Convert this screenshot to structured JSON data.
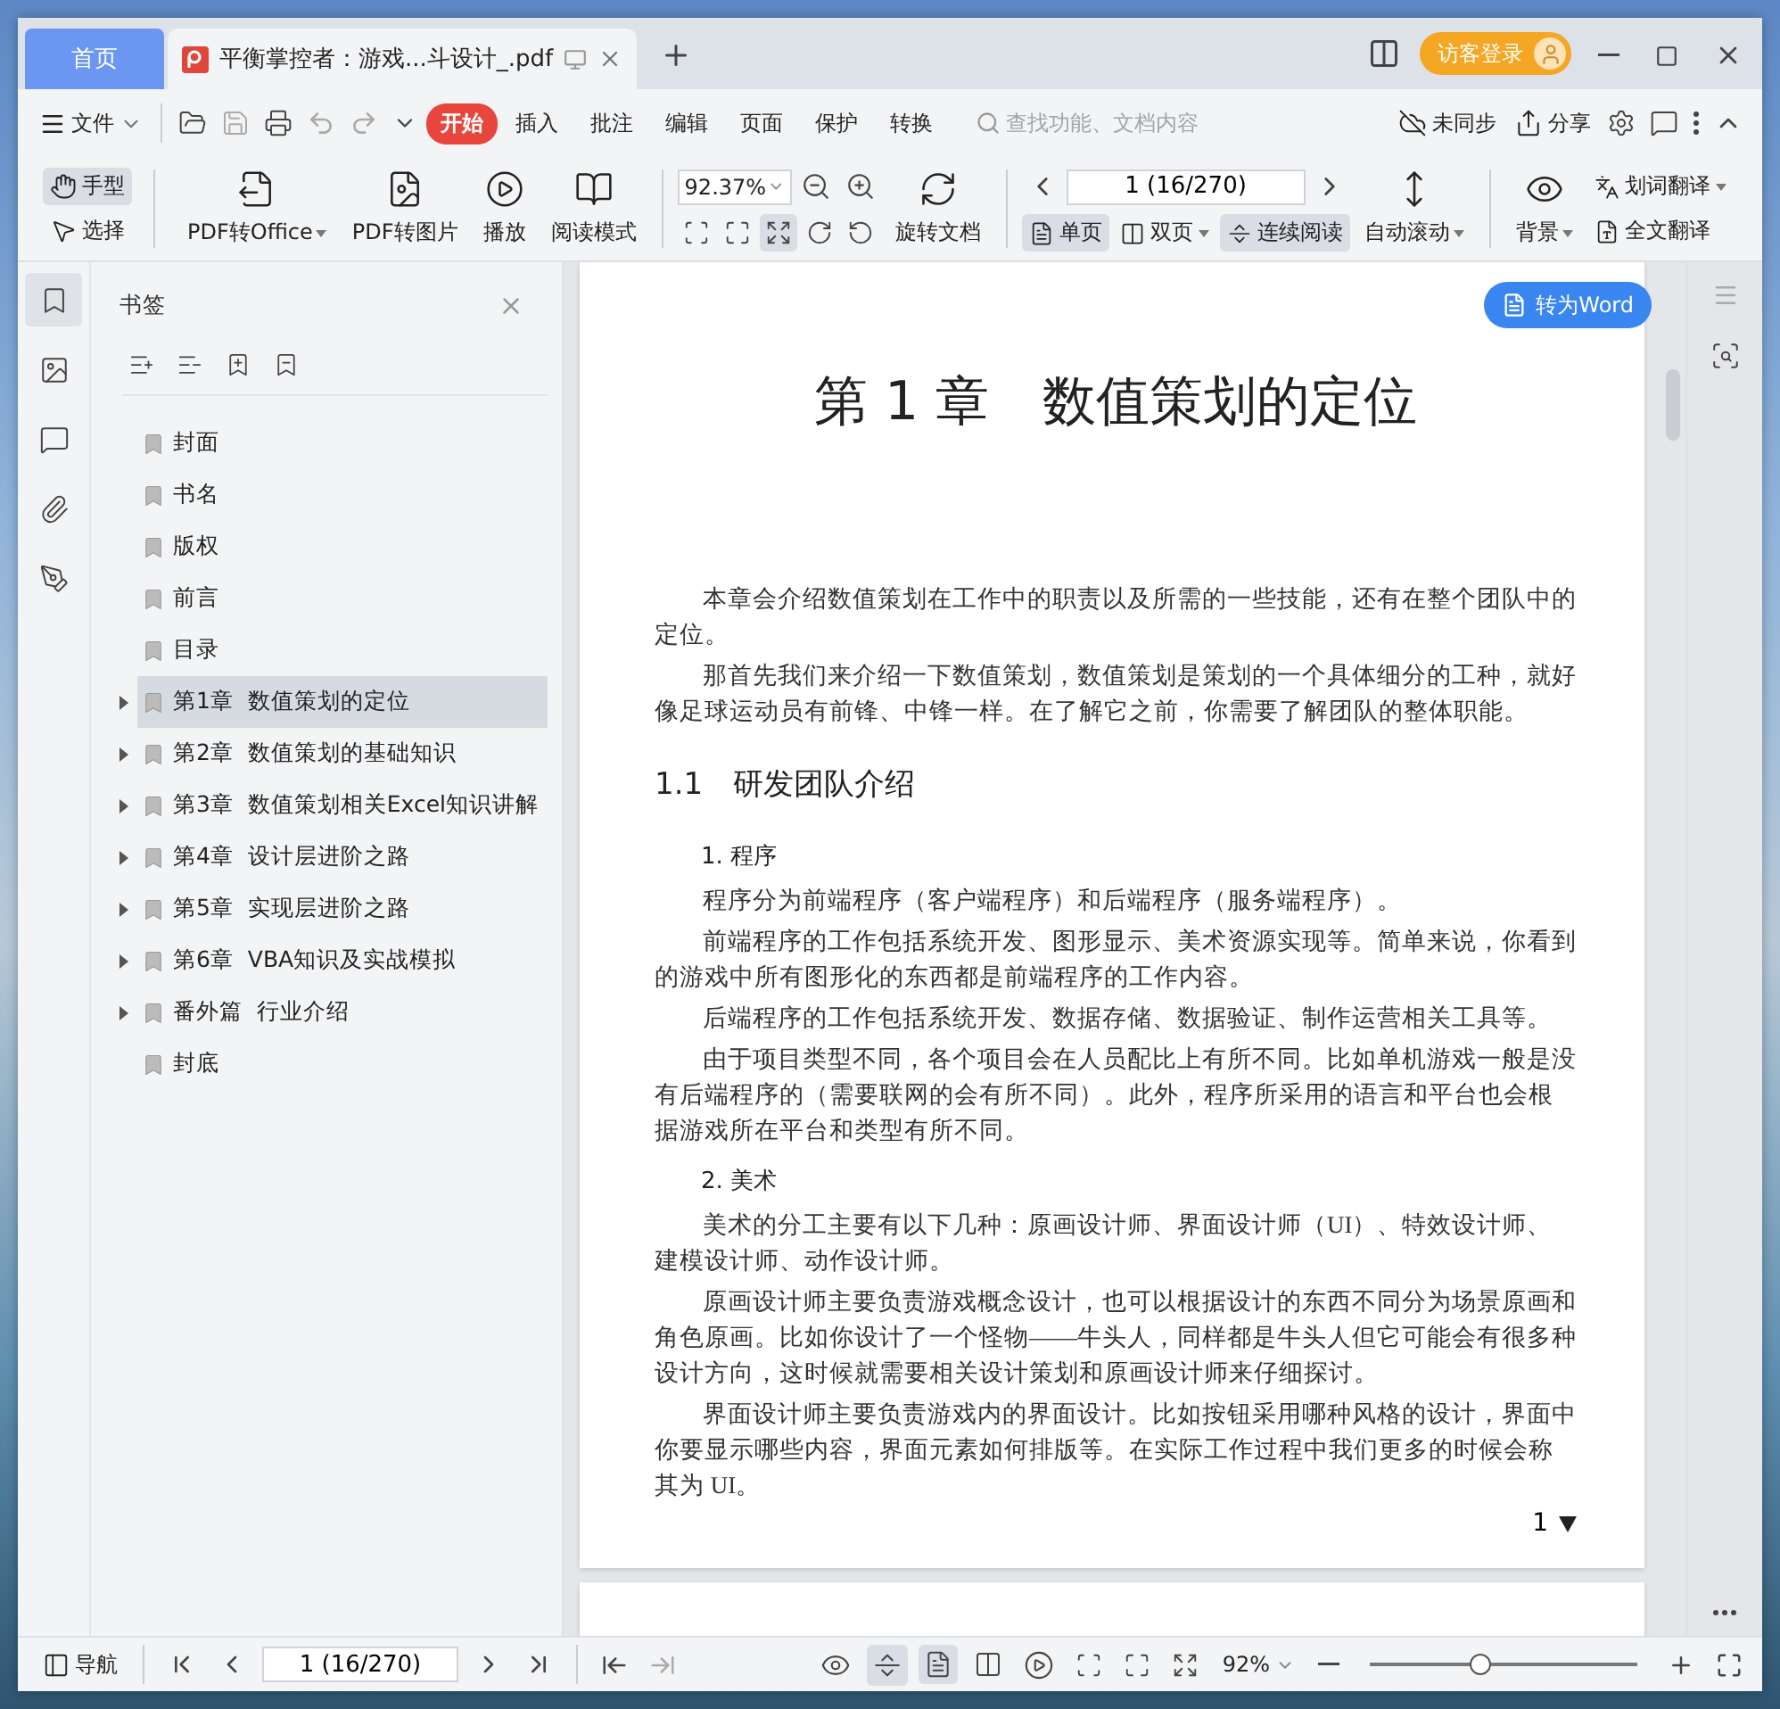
{
  "tabs": [
    {
      "label": "首页",
      "kind": "home",
      "selected": false
    },
    {
      "label": "平衡掌控者：游戏...斗设计_.pdf",
      "kind": "doc",
      "selected": true
    }
  ],
  "login_button": "访客登录",
  "menu": {
    "file": "文件",
    "items": [
      {
        "label": "开始",
        "selected": true
      },
      {
        "label": "插入",
        "selected": false
      },
      {
        "label": "批注",
        "selected": false
      },
      {
        "label": "编辑",
        "selected": false
      },
      {
        "label": "页面",
        "selected": false
      },
      {
        "label": "保护",
        "selected": false
      },
      {
        "label": "转换",
        "selected": false
      }
    ],
    "search": {
      "placeholder": "查找功能、文档内容"
    },
    "sync": "未同步",
    "share": "分享"
  },
  "toolbar": {
    "hand": {
      "label": "手型",
      "selected": true
    },
    "select": {
      "label": "选择",
      "selected": false
    },
    "tools": [
      {
        "label": "PDF转Office",
        "kind": "office",
        "dropdown": true
      },
      {
        "label": "PDF转图片",
        "kind": "image",
        "dropdown": false
      },
      {
        "label": "播放",
        "kind": "play",
        "dropdown": false
      },
      {
        "label": "阅读模式",
        "kind": "book",
        "dropdown": false
      }
    ],
    "zoom": "92.37%",
    "fit_width": {
      "selected": true
    },
    "rotate": "旋转文档",
    "page": "1 (16/270)",
    "single": {
      "label": "单页",
      "selected": true
    },
    "double": {
      "label": "双页",
      "selected": false
    },
    "continuous": {
      "label": "连续阅读",
      "selected": true
    },
    "auto_scroll": "自动滚动",
    "background": "背景",
    "word_translate": "划词翻译",
    "full_translate": "全文翻译"
  },
  "sidebar": {
    "title": "书签",
    "bookmarks": [
      {
        "label": "封面",
        "expandable": false,
        "selected": false
      },
      {
        "label": "书名",
        "expandable": false,
        "selected": false
      },
      {
        "label": "版权",
        "expandable": false,
        "selected": false
      },
      {
        "label": "前言",
        "expandable": false,
        "selected": false
      },
      {
        "label": "目录",
        "expandable": false,
        "selected": false
      },
      {
        "label": "第1章  数值策划的定位",
        "expandable": true,
        "selected": true
      },
      {
        "label": "第2章  数值策划的基础知识",
        "expandable": true,
        "selected": false
      },
      {
        "label": "第3章  数值策划相关Excel知识讲解",
        "expandable": true,
        "selected": false
      },
      {
        "label": "第4章  设计层进阶之路",
        "expandable": true,
        "selected": false
      },
      {
        "label": "第5章  实现层进阶之路",
        "expandable": true,
        "selected": false
      },
      {
        "label": "第6章  VBA知识及实战模拟",
        "expandable": true,
        "selected": false
      },
      {
        "label": "番外篇  行业介绍",
        "expandable": true,
        "selected": false
      },
      {
        "label": "封底",
        "expandable": false,
        "selected": false
      }
    ]
  },
  "document": {
    "convert_button": "转为Word",
    "chapter_title": "第 1 章　数值策划的定位",
    "blocks": [
      {
        "kind": "para",
        "text": "本章会介绍数值策划在工作中的职责以及所需的一些技能，还有在整个团队中的定位。"
      },
      {
        "kind": "para",
        "text": "那首先我们来介绍一下数值策划，数值策划是策划的一个具体细分的工种，就好像足球运动员有前锋、中锋一样。在了解它之前，你需要了解团队的整体职能。"
      },
      {
        "kind": "heading",
        "text": "1.1　研发团队介绍"
      },
      {
        "kind": "subheading",
        "text": "1. 程序"
      },
      {
        "kind": "para",
        "text": "程序分为前端程序（客户端程序）和后端程序（服务端程序）。"
      },
      {
        "kind": "para",
        "text": "前端程序的工作包括系统开发、图形显示、美术资源实现等。简单来说，你看到的游戏中所有图形化的东西都是前端程序的工作内容。"
      },
      {
        "kind": "para",
        "text": "后端程序的工作包括系统开发、数据存储、数据验证、制作运营相关工具等。"
      },
      {
        "kind": "para",
        "text": "由于项目类型不同，各个项目会在人员配比上有所不同。比如单机游戏一般是没有后端程序的（需要联网的会有所不同）。此外，程序所采用的语言和平台也会根据游戏所在平台和类型有所不同。"
      },
      {
        "kind": "subheading",
        "text": "2. 美术"
      },
      {
        "kind": "para",
        "text": "美术的分工主要有以下几种：原画设计师、界面设计师（UI）、特效设计师、建模设计师、动作设计师。"
      },
      {
        "kind": "para",
        "text": "原画设计师主要负责游戏概念设计，也可以根据设计的东西不同分为场景原画和角色原画。比如你设计了一个怪物——牛头人，同样都是牛头人但它可能会有很多种设计方向，这时候就需要相关设计策划和原画设计师来仔细探讨。"
      },
      {
        "kind": "para",
        "text": "界面设计师主要负责游戏内的界面设计。比如按钮采用哪种风格的设计，界面中你要显示哪些内容，界面元素如何排版等。在实际工作过程中我们更多的时候会称其为 UI。"
      }
    ],
    "page_number": "1"
  },
  "status_bar": {
    "nav": "导航",
    "page": "1 (16/270)",
    "zoom": "92%",
    "continuous": {
      "selected": true
    },
    "single": {
      "selected": true
    },
    "zoom_slider": {
      "level": 0.41
    }
  }
}
